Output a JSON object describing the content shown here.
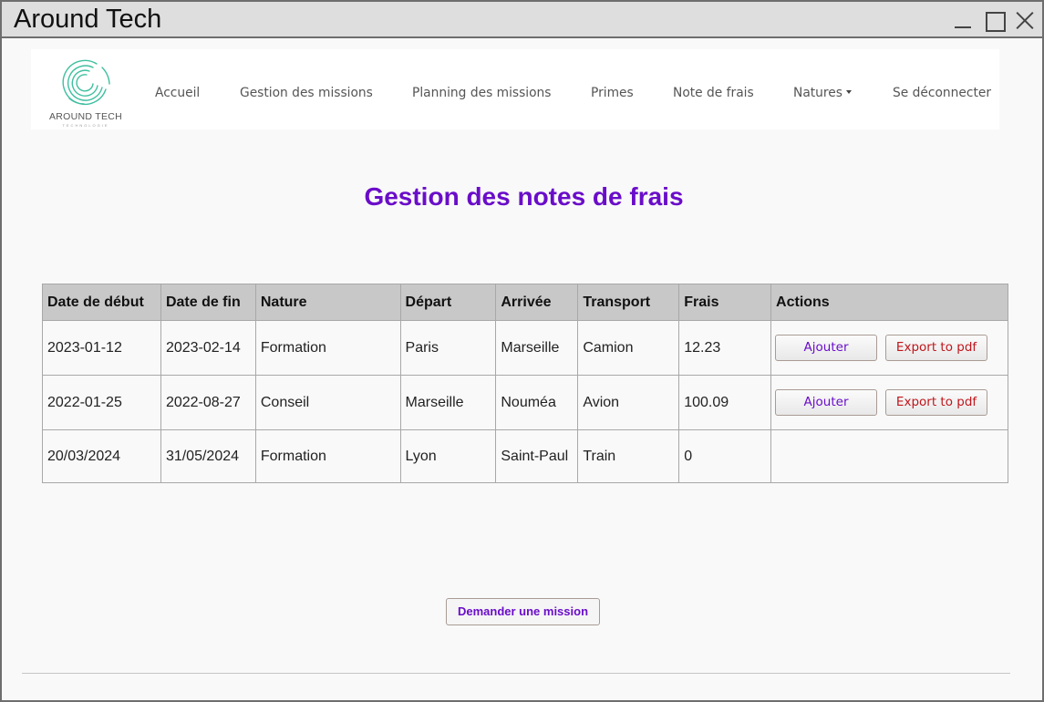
{
  "window": {
    "title": "Around Tech"
  },
  "brand": {
    "name": "AROUND TECH",
    "tagline": "TECHNOLOGIE",
    "accent": "#3fbfa0"
  },
  "nav": {
    "items": [
      {
        "label": "Accueil"
      },
      {
        "label": "Gestion des missions"
      },
      {
        "label": "Planning des missions"
      },
      {
        "label": "Primes"
      },
      {
        "label": "Note de frais"
      },
      {
        "label": "Natures"
      },
      {
        "label": "Se déconnecter"
      }
    ]
  },
  "page": {
    "title": "Gestion des notes de frais",
    "title_color": "#6a0dc9"
  },
  "table": {
    "headers": [
      "Date de début",
      "Date de fin",
      "Nature",
      "Départ",
      "Arrivée",
      "Transport",
      "Frais",
      "Actions"
    ],
    "rows": [
      {
        "debut": "2023-01-12",
        "fin": "2023-02-14",
        "nature": "Formation",
        "depart": "Paris",
        "arrivee": "Marseille",
        "transport": "Camion",
        "frais": "12.23"
      },
      {
        "debut": "2022-01-25",
        "fin": "2022-08-27",
        "nature": "Conseil",
        "depart": "Marseille",
        "arrivee": "Nouméa",
        "transport": "Avion",
        "frais": "100.09"
      },
      {
        "debut": "20/03/2024",
        "fin": "31/05/2024",
        "nature": "Formation",
        "depart": "Lyon",
        "arrivee": "Saint-Paul",
        "transport": "Train",
        "frais": "0"
      }
    ],
    "actions": {
      "add_label": "Ajouter",
      "pdf_label": "Export to pdf"
    }
  },
  "footer": {
    "mission_button": "Demander une mission"
  }
}
